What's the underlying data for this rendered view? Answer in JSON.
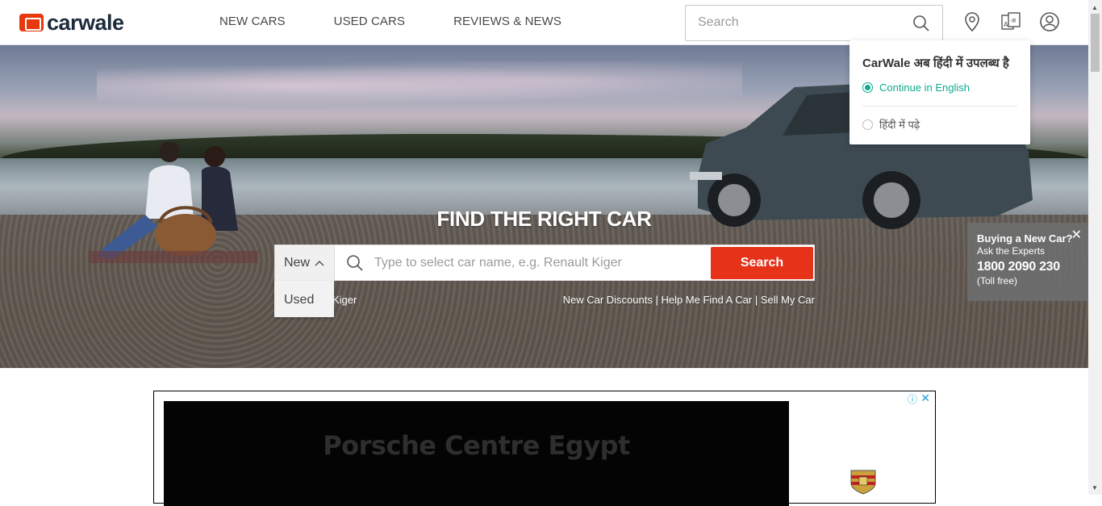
{
  "brand": {
    "name": "carwale",
    "accent": "#e8380d"
  },
  "nav": {
    "items": [
      "NEW CARS",
      "USED CARS",
      "REVIEWS & NEWS"
    ]
  },
  "header_search": {
    "placeholder": "Search",
    "icon": "search-icon"
  },
  "header_icons": [
    "location-pin-icon",
    "language-icon",
    "user-account-icon"
  ],
  "language_popup": {
    "title": "CarWale अब हिंदी में उपलब्ध है",
    "option_english": "Continue in English",
    "option_hindi": "हिंदी में पढ़े",
    "selected": "english",
    "accent": "#0eaa8f"
  },
  "hero": {
    "title": "FIND THE RIGHT CAR",
    "select_value": "New",
    "dropdown_options": [
      "Used"
    ],
    "search_placeholder": "Type to select car name, e.g. Renault Kiger",
    "search_button": "Search",
    "button_color": "#e53219",
    "trending_fragment": "Kiger",
    "quick_links": [
      "New Car Discounts",
      "Help Me Find A Car",
      "Sell My Car"
    ]
  },
  "expert_box": {
    "title": "Buying a New Car?",
    "subtitle": "Ask the Experts",
    "phone": "1800 2090 230",
    "note": "(Toll free)",
    "close": "✕"
  },
  "ad": {
    "title": "Porsche Centre Egypt",
    "info": "ⓘ",
    "close": "✕"
  }
}
